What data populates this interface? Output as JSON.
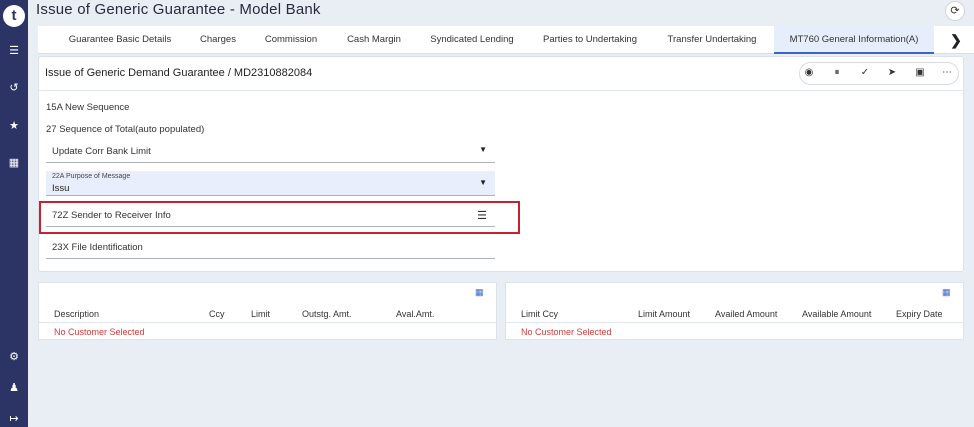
{
  "app": {
    "title": "Issue of Generic Guarantee - Model Bank",
    "logo_letter": "t"
  },
  "rail_icons": [
    "menu-icon",
    "history-icon",
    "star-icon",
    "apps-icon",
    "settings-icon",
    "users-icon",
    "logout-icon"
  ],
  "tabs": [
    {
      "label": "Guarantee Basic Details"
    },
    {
      "label": "Charges"
    },
    {
      "label": "Commission"
    },
    {
      "label": "Cash Margin"
    },
    {
      "label": "Syndicated Lending"
    },
    {
      "label": "Parties to Undertaking"
    },
    {
      "label": "Transfer Undertaking"
    },
    {
      "label": "MT760 General Information(A)",
      "active": true
    }
  ],
  "card": {
    "title": "Issue of Generic Demand Guarantee / MD2310882084",
    "toolbar": [
      "play-icon",
      "pause-icon",
      "check-icon",
      "send-icon",
      "inbox-icon",
      "more-icon"
    ]
  },
  "form": {
    "seq_label": "15A New Sequence",
    "total_label": "27 Sequence of Total(auto populated)",
    "corr_bank": "Update Corr Bank Limit",
    "purpose_label": "22A Purpose of Message",
    "purpose_value": "Issu",
    "sender_receiver": "72Z Sender to Receiver Info",
    "file_id": "23X File Identification"
  },
  "left_table": {
    "headers": [
      "Description",
      "Ccy",
      "Limit",
      "Outstg. Amt.",
      "Aval.Amt."
    ],
    "empty": "No Customer Selected"
  },
  "right_table": {
    "headers": [
      "Limit Ccy",
      "Limit Amount",
      "Availed Amount",
      "Available Amount",
      "Expiry Date"
    ],
    "empty": "No Customer Selected"
  },
  "colors": {
    "rail": "#2b3465",
    "accent": "#3b65c7",
    "highlight": "#c8202f",
    "error": "#d33a3a"
  }
}
